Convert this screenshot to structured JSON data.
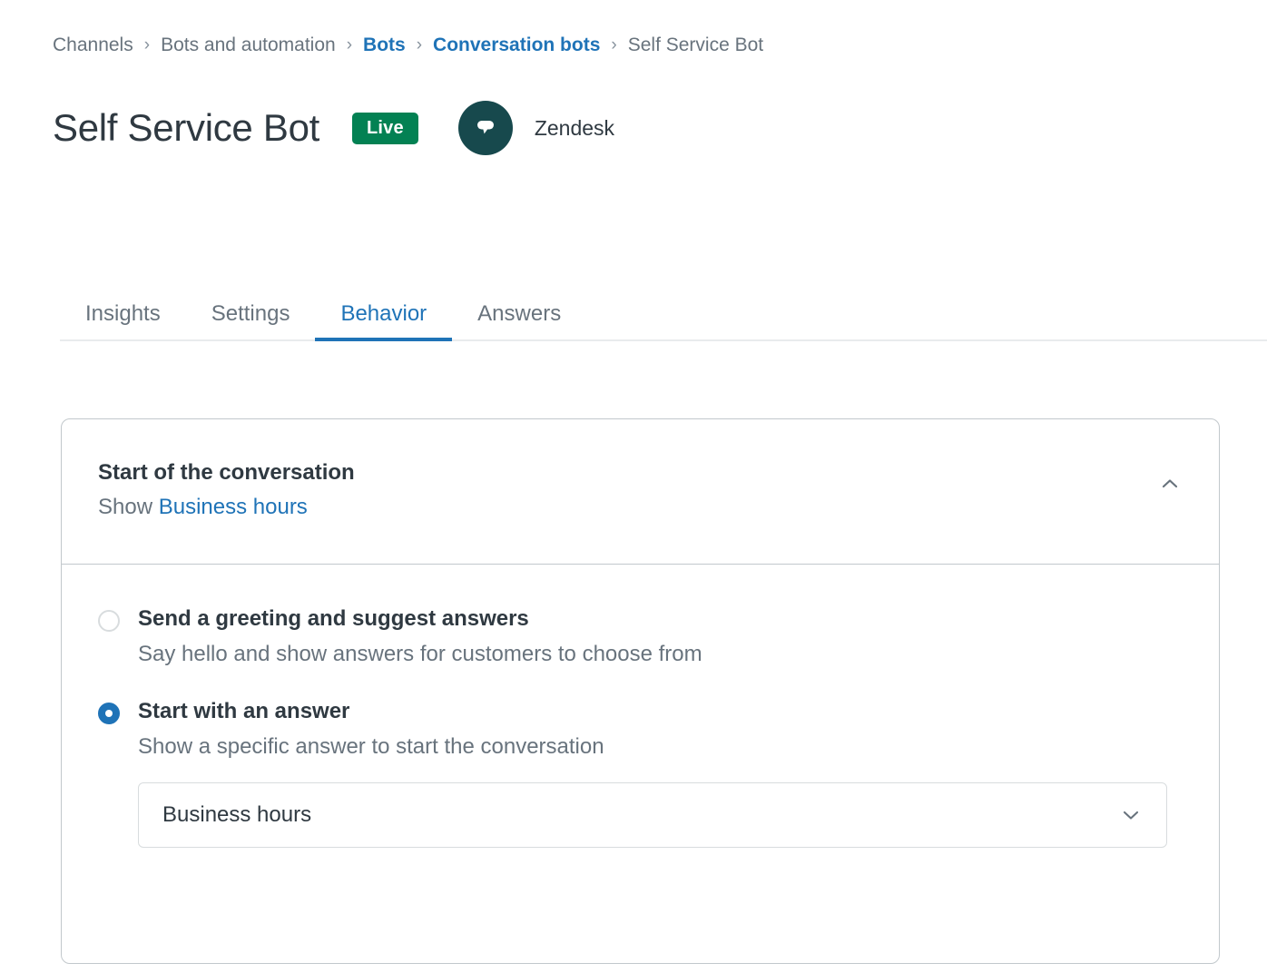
{
  "breadcrumb": {
    "separator": "›",
    "items": [
      {
        "label": "Channels",
        "link": false
      },
      {
        "label": "Bots and automation",
        "link": false
      },
      {
        "label": "Bots",
        "link": true
      },
      {
        "label": "Conversation bots",
        "link": true
      },
      {
        "label": "Self Service Bot",
        "link": false
      }
    ]
  },
  "header": {
    "title": "Self Service Bot",
    "status_badge": "Live",
    "channel_name": "Zendesk",
    "avatar_icon": "chat-bubble-icon"
  },
  "tabs": [
    {
      "label": "Insights",
      "active": false
    },
    {
      "label": "Settings",
      "active": false
    },
    {
      "label": "Behavior",
      "active": true
    },
    {
      "label": "Answers",
      "active": false
    }
  ],
  "card": {
    "title": "Start of the conversation",
    "subtitle_prefix": "Show",
    "subtitle_link": "Business hours",
    "collapse_icon": "chevron-up-icon",
    "options": [
      {
        "label": "Send a greeting and suggest answers",
        "description": "Say hello and show answers for customers to choose from",
        "selected": false
      },
      {
        "label": "Start with an answer",
        "description": "Show a specific answer to start the conversation",
        "selected": true
      }
    ],
    "answer_select": {
      "value": "Business hours",
      "chevron_icon": "chevron-down-icon"
    }
  },
  "colors": {
    "accent_blue": "#1f73b7",
    "badge_green": "#038153",
    "avatar_teal": "#17494d",
    "text_primary": "#2f3941",
    "text_secondary": "#68737d",
    "border": "#c2c8cc"
  }
}
